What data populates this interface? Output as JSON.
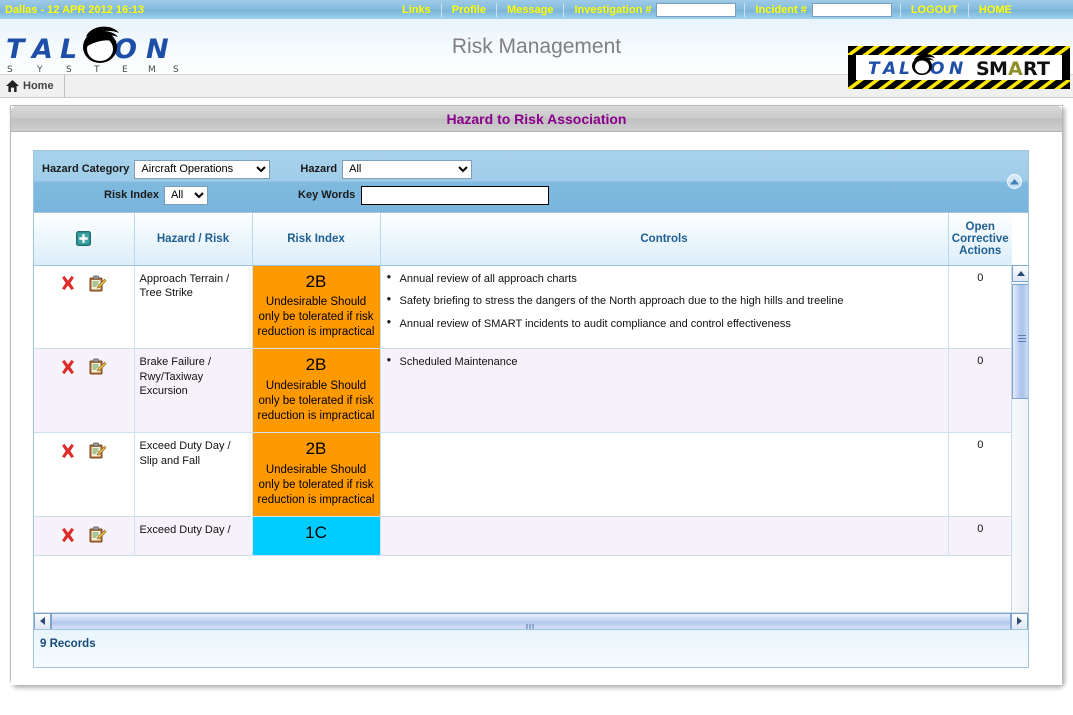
{
  "topbar": {
    "datetime": "Dallas - 12 APR 2012 16:13",
    "links": [
      {
        "label": "Links",
        "name": "links"
      },
      {
        "label": "Profile",
        "name": "profile"
      },
      {
        "label": "Message",
        "name": "message"
      }
    ],
    "investigation_label": "Investigation #",
    "investigation_value": "",
    "incident_label": "Incident #",
    "incident_value": "",
    "logout_label": "LOGOUT",
    "home_label": "HOME",
    "text_color": "#ffff00",
    "bg_color": "#86bcdf"
  },
  "header": {
    "app_title": "Risk Management",
    "logo_primary": "TALON",
    "logo_primary_sub": "S Y S T E M S",
    "logo_secondary_left": "TALON",
    "logo_secondary_right": "SMART"
  },
  "breadcrumb": {
    "home_label": "Home",
    "home_icon": "home-icon"
  },
  "panel": {
    "title": "Hazard to Risk Association",
    "title_color": "#8b008b"
  },
  "filters": {
    "hazard_category_label": "Hazard Category",
    "hazard_category_value": "Aircraft Operations",
    "hazard_label": "Hazard",
    "hazard_value": "All",
    "risk_index_label": "Risk Index",
    "risk_index_value": "All",
    "key_words_label": "Key Words",
    "key_words_value": "",
    "key_words_placeholder": "",
    "collapse_icon": "chevron-up-icon"
  },
  "grid": {
    "add_icon": "add-plus-icon",
    "columns": [
      {
        "key": "actions",
        "label": ""
      },
      {
        "key": "hazard",
        "label": "Hazard / Risk"
      },
      {
        "key": "index",
        "label": "Risk Index"
      },
      {
        "key": "controls",
        "label": "Controls"
      },
      {
        "key": "open",
        "label": "Open Corrective Actions"
      }
    ],
    "rows": [
      {
        "hazard": "Approach Terrain / Tree Strike",
        "index_code": "2B",
        "index_text": "Undesirable Should only be tolerated if risk reduction is impractical",
        "index_color": "#FF9900",
        "controls": [
          "Annual review of all approach charts",
          "Safety briefing to stress the dangers of the North approach due to the high hills and treeline",
          "Annual review of SMART incidents to audit compliance and control effectiveness"
        ],
        "open_actions": "0",
        "delete_icon": "delete-x-icon",
        "edit_icon": "edit-clipboard-icon"
      },
      {
        "hazard": "Brake Failure / Rwy/Taxiway Excursion",
        "index_code": "2B",
        "index_text": "Undesirable Should only be tolerated if risk reduction is impractical",
        "index_color": "#FF9900",
        "controls": [
          "Scheduled Maintenance"
        ],
        "open_actions": "0",
        "delete_icon": "delete-x-icon",
        "edit_icon": "edit-clipboard-icon"
      },
      {
        "hazard": "Exceed Duty Day / Slip and Fall",
        "index_code": "2B",
        "index_text": "Undesirable Should only be tolerated if risk reduction is impractical",
        "index_color": "#FF9900",
        "controls": [],
        "open_actions": "0",
        "delete_icon": "delete-x-icon",
        "edit_icon": "edit-clipboard-icon"
      },
      {
        "hazard": "Exceed Duty Day /",
        "index_code": "1C",
        "index_text": "",
        "index_color": "#00CCFF",
        "controls": [],
        "open_actions": "0",
        "delete_icon": "delete-x-icon",
        "edit_icon": "edit-clipboard-icon"
      }
    ]
  },
  "footer": {
    "records_text": "9 Records"
  }
}
